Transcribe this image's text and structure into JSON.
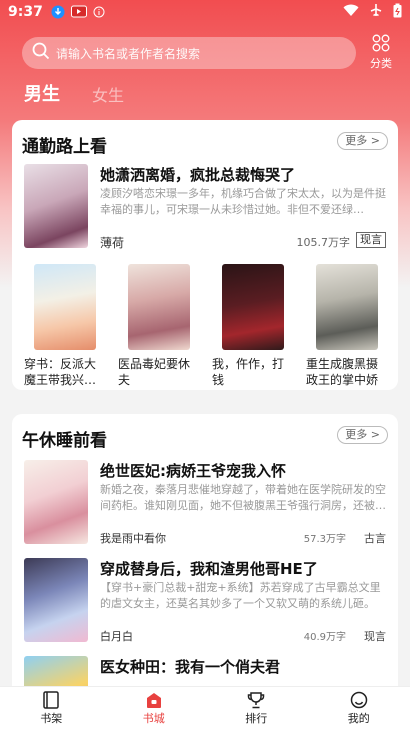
{
  "status": {
    "time": "9:37"
  },
  "search": {
    "placeholder": "请输入书名或者作者名搜索"
  },
  "category_label": "分类",
  "gender_tabs": [
    {
      "label": "男生"
    },
    {
      "label": "女生"
    }
  ],
  "section1": {
    "title": "通勤路上看",
    "more": "更多 >",
    "featured": {
      "title": "她潇洒离婚，疯批总裁悔哭了",
      "desc": "凌顾汐嗒恋宋璟一多年，机缘巧合做了宋太太，以为是件挺幸福的事儿，可宋璟一从未珍惜过她。非但不爱还绿…",
      "author": "薄荷",
      "words": "105.7万字",
      "genre": "现言"
    },
    "grid": [
      {
        "title": "穿书：反派大魔王带我兴…"
      },
      {
        "title": "医品毒妃要休夫"
      },
      {
        "title": "我，仵作，打钱"
      },
      {
        "title": "重生成腹黑摄政王的掌中娇"
      }
    ]
  },
  "section2": {
    "title": "午休睡前看",
    "more": "更多 >",
    "books": [
      {
        "title": "绝世医妃:病娇王爷宠我入怀",
        "desc": "新婚之夜，秦落月悲催地穿越了，带着她在医学院研发的空间药柜。谁知刚见面，她不但被腹黑王爷强行洞房，还被…",
        "author": "我是雨中看你",
        "words": "57.3万字",
        "genre": "古言"
      },
      {
        "title": "穿成替身后，我和渣男他哥HE了",
        "desc": "【穿书+豪门总裁+甜宠+系统】苏若穿成了古早霸总文里的虐文女主，还莫名其妙多了一个又软又萌的系统儿砸。按…",
        "author": "白月白",
        "words": "40.9万字",
        "genre": "现言"
      },
      {
        "title": "医女种田：我有一个俏夫君"
      }
    ]
  },
  "bottom_nav": [
    {
      "label": "书架",
      "icon": "bookshelf-icon"
    },
    {
      "label": "书城",
      "icon": "bookstore-icon"
    },
    {
      "label": "排行",
      "icon": "trophy-icon"
    },
    {
      "label": "我的",
      "icon": "profile-icon"
    }
  ],
  "colors": {
    "accent": "#e8413f",
    "header_top": "#f24d50"
  }
}
